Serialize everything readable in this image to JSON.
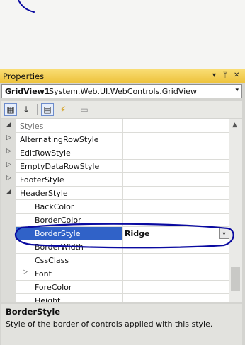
{
  "panel": {
    "title": "Properties",
    "controls": {
      "dropdown": "▾",
      "pin": "ᛘ",
      "close": "✕"
    }
  },
  "object_selector": {
    "name": "GridView1",
    "type": "System.Web.UI.WebControls.GridView",
    "arrow": "▾"
  },
  "toolbar": {
    "icons": [
      "categorized-icon",
      "alphabetical-icon",
      "properties-icon",
      "events-icon",
      "property-pages-icon"
    ],
    "glyphs": {
      "categorized": "▦",
      "alphabetical": "↓",
      "properties": "▤",
      "events": "⚡",
      "pages": "▭"
    }
  },
  "grid": {
    "rows": [
      {
        "name": "Styles",
        "value": "",
        "kind": "category",
        "expander": "◢"
      },
      {
        "name": "AlternatingRowStyle",
        "value": "",
        "kind": "group",
        "expander": "▷"
      },
      {
        "name": "EditRowStyle",
        "value": "",
        "kind": "group",
        "expander": "▷"
      },
      {
        "name": "EmptyDataRowStyle",
        "value": "",
        "kind": "group",
        "expander": "▷"
      },
      {
        "name": "FooterStyle",
        "value": "",
        "kind": "group",
        "expander": "▷"
      },
      {
        "name": "HeaderStyle",
        "value": "",
        "kind": "group",
        "expander": "◢"
      },
      {
        "name": "BackColor",
        "value": "",
        "kind": "child",
        "expander": ""
      },
      {
        "name": "BorderColor",
        "value": "",
        "kind": "child",
        "expander": ""
      },
      {
        "name": "BorderStyle",
        "value": "Ridge",
        "kind": "selected",
        "expander": ""
      },
      {
        "name": "BorderWidth",
        "value": "",
        "kind": "child",
        "expander": ""
      },
      {
        "name": "CssClass",
        "value": "",
        "kind": "child",
        "expander": ""
      },
      {
        "name": "Font",
        "value": "",
        "kind": "childgroup",
        "expander": "▷"
      },
      {
        "name": "ForeColor",
        "value": "",
        "kind": "child",
        "expander": ""
      },
      {
        "name": "Height",
        "value": "",
        "kind": "child",
        "expander": ""
      }
    ],
    "value_dropdown_arrow": "▾",
    "scroll_up": "▲"
  },
  "description": {
    "title": "BorderStyle",
    "text": "Style of the border of controls applied with this style."
  },
  "colors": {
    "title_bar": "#f2cc4f",
    "selection": "#3062c8",
    "annotation_ink": "#0a0aa0"
  }
}
